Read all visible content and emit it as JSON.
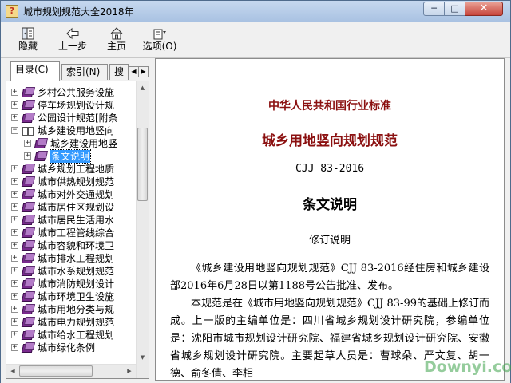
{
  "window": {
    "title": "城市规划规范大全2018年",
    "app_icon_glyph": "?"
  },
  "window_controls": {
    "minimize": "─",
    "maximize": "□",
    "close": "✕"
  },
  "toolbar": {
    "hide_label": "隐藏",
    "back_label": "上一步",
    "home_label": "主页",
    "options_label": "选项(O)"
  },
  "tabs": {
    "contents": "目录(C)",
    "index": "索引(N)",
    "search": "搜"
  },
  "tree": {
    "items": [
      {
        "label": "乡村公共服务设施",
        "level": 0,
        "expander": "+"
      },
      {
        "label": "停车场规划设计规",
        "level": 0,
        "expander": "+"
      },
      {
        "label": "公园设计规范[附条",
        "level": 0,
        "expander": "+"
      },
      {
        "label": "城乡建设用地竖向",
        "level": 0,
        "expander": "−"
      },
      {
        "label": "城乡建设用地竖",
        "level": 1,
        "expander": "+"
      },
      {
        "label": "条文说明",
        "level": 1,
        "expander": "+"
      },
      {
        "label": "城乡规划工程地质",
        "level": 0,
        "expander": "+"
      },
      {
        "label": "城市供热规划规范",
        "level": 0,
        "expander": "+"
      },
      {
        "label": "城市对外交通规划",
        "level": 0,
        "expander": "+"
      },
      {
        "label": "城市居住区规划设",
        "level": 0,
        "expander": "+"
      },
      {
        "label": "城市居民生活用水",
        "level": 0,
        "expander": "+"
      },
      {
        "label": "城市工程管线综合",
        "level": 0,
        "expander": "+"
      },
      {
        "label": "城市容貌和环境卫",
        "level": 0,
        "expander": "+"
      },
      {
        "label": "城市排水工程规划",
        "level": 0,
        "expander": "+"
      },
      {
        "label": "城市水系规划规范",
        "level": 0,
        "expander": "+"
      },
      {
        "label": "城市消防规划设计",
        "level": 0,
        "expander": "+"
      },
      {
        "label": "城市环境卫生设施",
        "level": 0,
        "expander": "+"
      },
      {
        "label": "城市用地分类与规",
        "level": 0,
        "expander": "+"
      },
      {
        "label": "城市电力规划规范",
        "level": 0,
        "expander": "+"
      },
      {
        "label": "城市给水工程规划",
        "level": 0,
        "expander": "+"
      },
      {
        "label": "城市绿化条例",
        "level": 0,
        "expander": "+"
      }
    ],
    "selected_label": "条文说明"
  },
  "document": {
    "header": "中华人民共和国行业标准",
    "title": "城乡用地竖向规划规范",
    "code": "CJJ 83-2016",
    "section": "条文说明",
    "subsection": "修订说明",
    "paragraph1": "《城乡建设用地竖向规划规范》CJJ 83-2016经住房和城乡建设部2016年6月28日以第1188号公告批准、发布。",
    "paragraph2": "本规范是在《城市用地竖向规划规范》CJJ 83-99的基础上修订而成。上一版的主编单位是：四川省城乡规划设计研究院，参编单位是：沈阳市城市规划设计研究院、福建省城乡规划设计研究院、安徽省城乡规划设计研究院。主要起草人员是：曹球朵、严文复、胡一德、俞冬倩、李相"
  },
  "watermark": "Downyi.com",
  "colors": {
    "heading_red": "#8b1010",
    "selection_blue": "#3399ff",
    "book_purple": "#7a2a8e"
  }
}
